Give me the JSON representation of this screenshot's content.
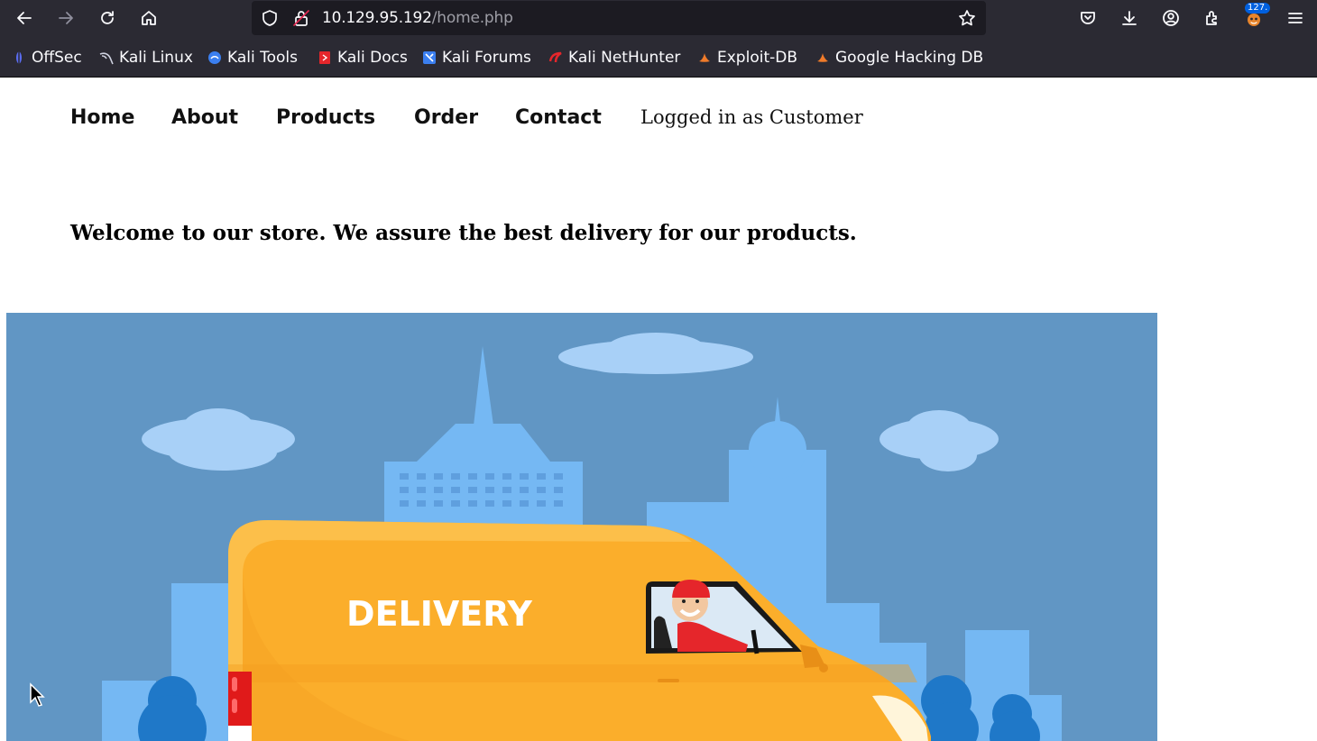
{
  "browser": {
    "url_host": "10.129.95.192",
    "url_path": "/home.php",
    "extension_badge": "127.",
    "icons": [
      "back-icon",
      "forward-icon",
      "reload-icon",
      "home-icon",
      "shield-icon",
      "lock-icon",
      "star-icon",
      "pocket-icon",
      "download-icon",
      "account-icon",
      "extensions-icon",
      "menu-icon"
    ]
  },
  "bookmarks": [
    {
      "label": "OffSec",
      "color": "#5a6cf0"
    },
    {
      "label": "Kali Linux",
      "color": "#cfd2e0"
    },
    {
      "label": "Kali Tools",
      "color": "#3b7ff0"
    },
    {
      "label": "Kali Docs",
      "color": "#e5262b"
    },
    {
      "label": "Kali Forums",
      "color": "#3b7ff0"
    },
    {
      "label": "Kali NetHunter",
      "color": "#e5262b"
    },
    {
      "label": "Exploit-DB",
      "color": "#f07b2a"
    },
    {
      "label": "Google Hacking DB",
      "color": "#f07b2a"
    }
  ],
  "nav": {
    "items": [
      "Home",
      "About",
      "Products",
      "Order",
      "Contact"
    ],
    "status": "Logged in as Customer"
  },
  "main": {
    "welcome": "Welcome to our store. We assure the best delivery for our products.",
    "hero_van_text": "DELIVERY"
  },
  "colors": {
    "toolbar_bg": "#2b2a33",
    "urlbar_bg": "#1c1b22",
    "hero_sky": "#6196c4",
    "van_yellow": "#fbae2b"
  }
}
